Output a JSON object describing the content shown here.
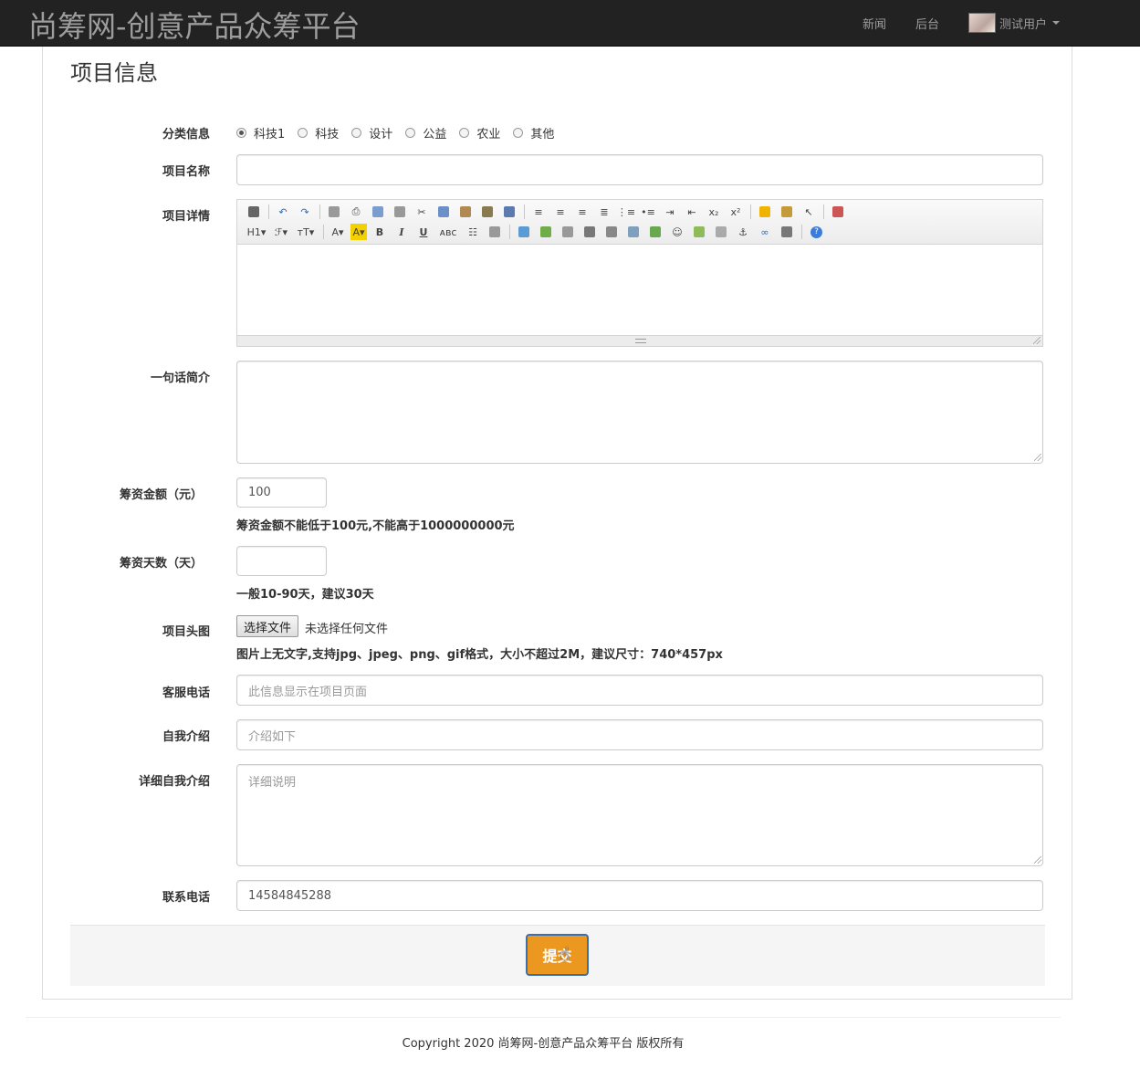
{
  "navbar": {
    "brand": "尚筹网-创意产品众筹平台",
    "links": [
      "新闻",
      "后台"
    ],
    "user": "测试用户"
  },
  "page": {
    "title": "项目信息"
  },
  "form": {
    "category": {
      "label": "分类信息",
      "options": [
        "科技1",
        "科技",
        "设计",
        "公益",
        "农业",
        "其他"
      ],
      "selected": "科技1"
    },
    "project_name": {
      "label": "项目名称",
      "value": ""
    },
    "project_detail": {
      "label": "项目详情"
    },
    "short_intro": {
      "label": "一句话简介",
      "value": ""
    },
    "amount": {
      "label": "筹资金额（元）",
      "value": "100",
      "help": "筹资金额不能低于100元,不能高于1000000000元"
    },
    "days": {
      "label": "筹资天数（天）",
      "value": "",
      "help": "一般10-90天，建议30天"
    },
    "head_image": {
      "label": "项目头图",
      "button": "选择文件",
      "status": "未选择任何文件",
      "help": "图片上无文字,支持jpg、jpeg、png、gif格式，大小不超过2M，建议尺寸：740*457px"
    },
    "service_phone": {
      "label": "客服电话",
      "placeholder": "此信息显示在项目页面"
    },
    "self_intro": {
      "label": "自我介绍",
      "placeholder": "介绍如下"
    },
    "detail_self_intro": {
      "label": "详细自我介绍",
      "placeholder": "详细说明"
    },
    "contact_phone": {
      "label": "联系电话",
      "value": "14584845288"
    },
    "submit": "提交"
  },
  "editor_toolbar": {
    "row1": [
      "source-icon",
      "undo-icon",
      "redo-icon",
      "preview-icon",
      "print-icon",
      "template-icon",
      "code-icon",
      "cut-icon",
      "copy-icon",
      "paste-icon",
      "paste-text-icon",
      "paste-word-icon",
      "align-left-icon",
      "align-center-icon",
      "align-right-icon",
      "justify-icon",
      "ordered-list-icon",
      "unordered-list-icon",
      "indent-icon",
      "outdent-icon",
      "subscript-icon",
      "superscript-icon",
      "clear-format-icon",
      "select-all-icon",
      "cursor-icon",
      "fullscreen-icon"
    ],
    "row2": [
      "heading-icon",
      "font-family-icon",
      "font-size-icon",
      "font-color-icon",
      "highlight-icon",
      "bold-icon",
      "italic-icon",
      "underline-icon",
      "strikethrough-icon",
      "line-height-icon",
      "remove-format-icon",
      "image-icon",
      "multi-image-icon",
      "flash-icon",
      "media-icon",
      "attachment-icon",
      "table-icon",
      "insert-hr-icon",
      "emoticon-icon",
      "baidu-map-icon",
      "page-break-icon",
      "anchor-icon",
      "link-icon",
      "unlink-icon",
      "help-icon"
    ]
  },
  "footer": {
    "copyright": "Copyright 2020 尚筹网-创意产品众筹平台 版权所有"
  },
  "colors": {
    "navbar": "#222222",
    "submit": "#ec971f",
    "submit_border": "#3a6fb0"
  }
}
